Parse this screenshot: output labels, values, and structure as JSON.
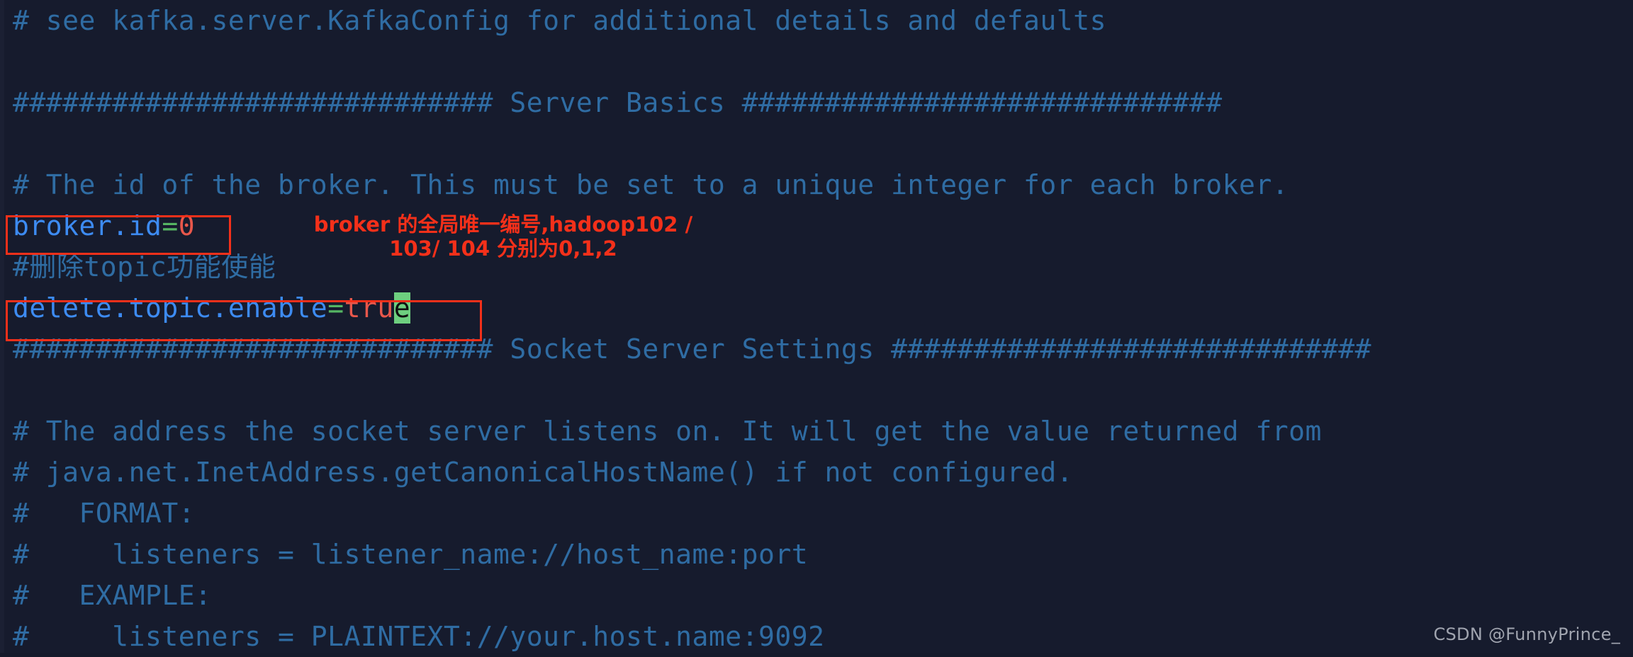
{
  "editor": {
    "background_color": "#161b2d",
    "comment_color": "#2f6ca3",
    "key_color": "#3d8bf2",
    "equals_color": "#55b563",
    "value_color": "#e8574b",
    "cursor_color": "#6ecf7f",
    "annotation_color": "#f4301a"
  },
  "lines": {
    "l1": "# see kafka.server.KafkaConfig for additional details and defaults",
    "l2": "",
    "l3": "############################# Server Basics #############################",
    "l4": "",
    "l5": "# The id of the broker. This must be set to a unique integer for each broker.",
    "l6_key": "broker.id",
    "l6_eq": "=",
    "l6_val": "0",
    "l7": "#删除topic功能使能",
    "l8_key": "delete.topic.enable",
    "l8_eq": "=",
    "l8_val": "tru",
    "l8_cursor": "e",
    "l9": "############################# Socket Server Settings #############################",
    "l10": "",
    "l11": "# The address the socket server listens on. It will get the value returned from",
    "l12": "# java.net.InetAddress.getCanonicalHostName() if not configured.",
    "l13": "#   FORMAT:",
    "l14": "#     listeners = listener_name://host_name:port",
    "l15": "#   EXAMPLE:",
    "l16": "#     listeners = PLAINTEXT://your.host.name:9092"
  },
  "annotations": {
    "broker_note_line1": "broker 的全局唯一编号,hadoop102 /",
    "broker_note_line2": "103/ 104 分别为0,1,2"
  },
  "watermark": {
    "text": "CSDN @FunnyPrince_"
  }
}
